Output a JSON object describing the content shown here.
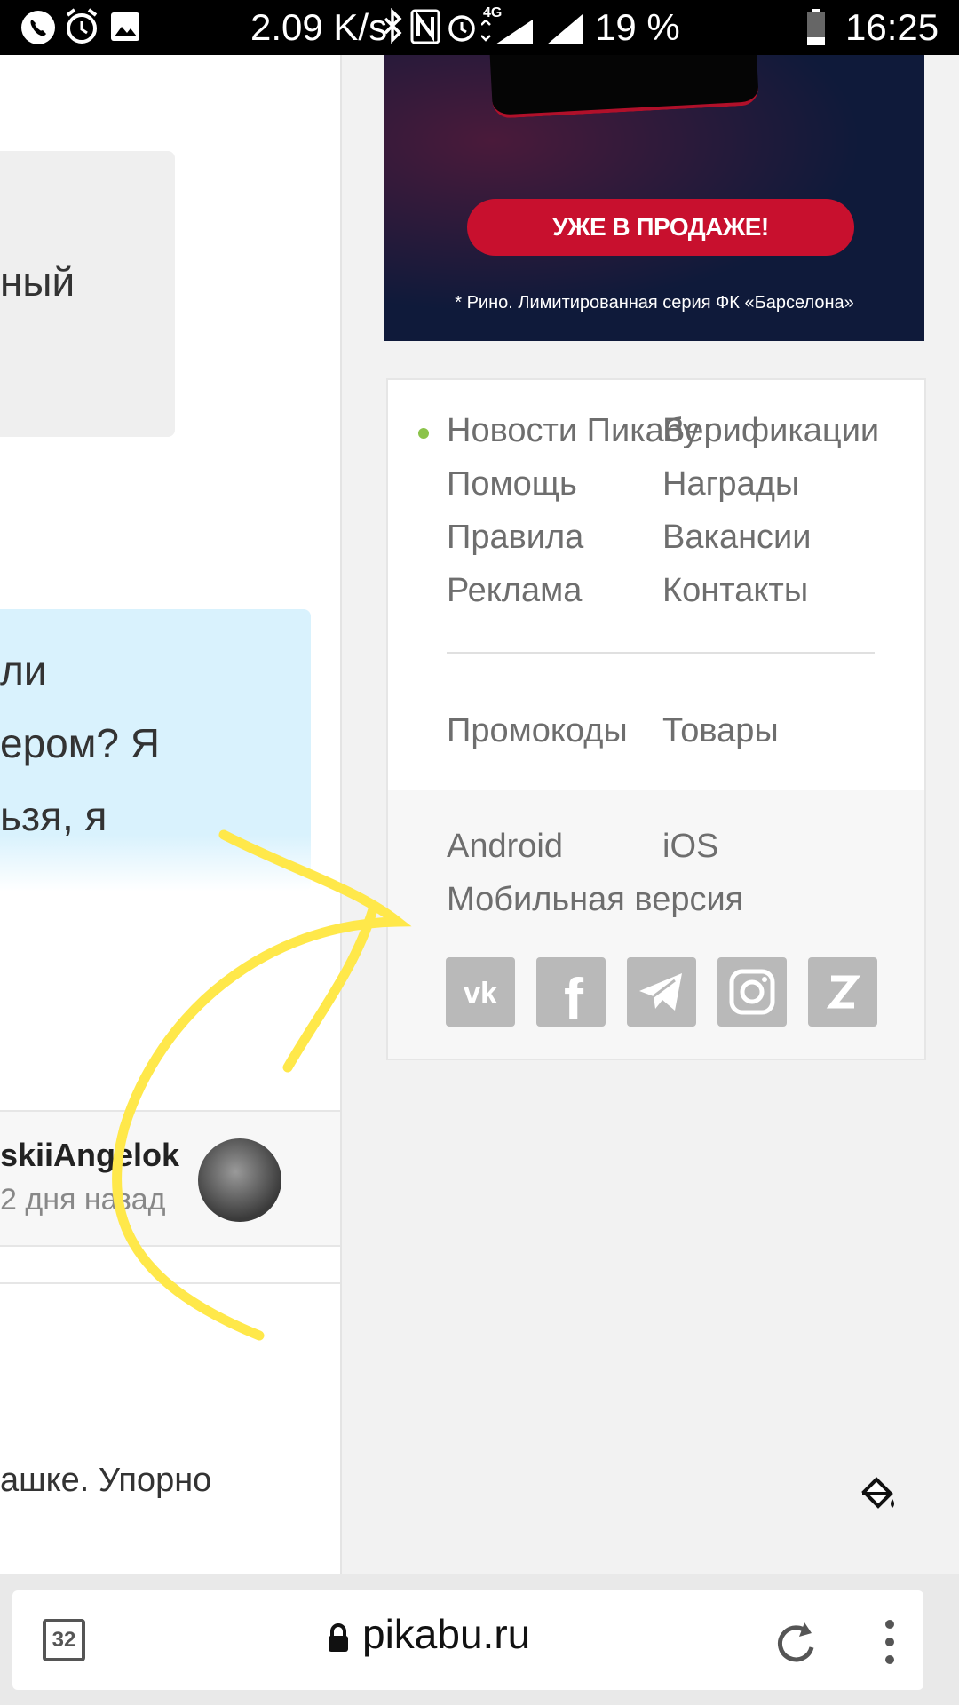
{
  "status_bar": {
    "net_speed": "2.09 K/s",
    "network": "4G",
    "battery": "19 %",
    "time": "16:25"
  },
  "left_column": {
    "card1_text": "ный",
    "card2_lines": [
      "ли",
      "ером? Я",
      "ьзя, я"
    ],
    "author": "skiiAngelok",
    "time_ago": "2 дня назад",
    "comment_text": "ашке. Упорно"
  },
  "ad": {
    "button_label": "УЖЕ В ПРОДАЖЕ!",
    "footnote": "* Рино. Лимитированная серия ФК «Барселона»"
  },
  "footer_menu": {
    "left_links": [
      "Новости Пикабу",
      "Помощь",
      "Правила",
      "Реклама"
    ],
    "right_links": [
      "Верификации",
      "Награды",
      "Вакансии",
      "Контакты"
    ],
    "promo": "Промокоды",
    "goods": "Товары",
    "android": "Android",
    "ios": "iOS",
    "mobile": "Мобильная версия"
  },
  "social_icons": [
    "vk-icon",
    "facebook-icon",
    "telegram-icon",
    "instagram-icon",
    "zen-icon"
  ],
  "address_bar": {
    "tabs_count": "32",
    "url": "pikabu.ru"
  },
  "colors": {
    "accent_dot": "#8bc34a",
    "link_gray": "#6e6e6e",
    "annotation_yellow": "#ffe84a"
  }
}
